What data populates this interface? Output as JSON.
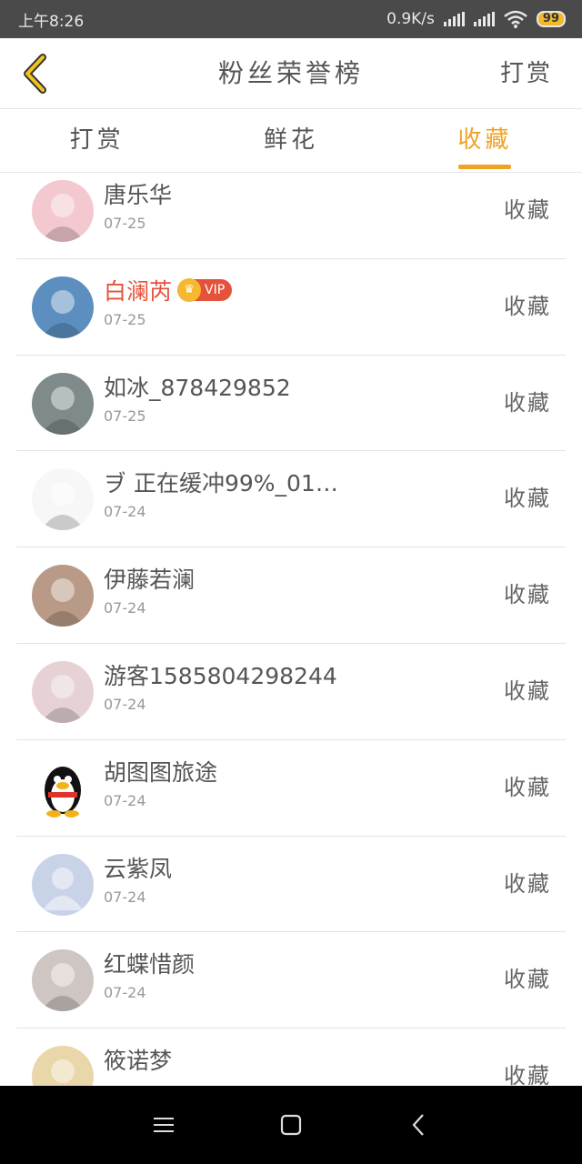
{
  "status_bar": {
    "time": "上午8:26",
    "net_speed": "0.9K/s",
    "battery": "99"
  },
  "header": {
    "title": "粉丝荣誉榜",
    "action_label": "打赏"
  },
  "tabs": [
    {
      "label": "打赏",
      "active": false
    },
    {
      "label": "鲜花",
      "active": false
    },
    {
      "label": "收藏",
      "active": true
    }
  ],
  "fans": [
    {
      "name": "唐乐华",
      "date": "07-25",
      "action": "收藏",
      "vip": false,
      "avatar_icon": "anime-girl-pink-avatar",
      "avatar_color": "#f3c9cf"
    },
    {
      "name": "白澜芮",
      "date": "07-25",
      "action": "收藏",
      "vip": true,
      "vip_label": "VIP",
      "avatar_icon": "girl-back-view-avatar",
      "avatar_color": "#5c8fbf"
    },
    {
      "name": "如冰_878429852",
      "date": "07-25",
      "action": "收藏",
      "vip": false,
      "avatar_icon": "ocean-wave-avatar",
      "avatar_color": "#7f8a8a"
    },
    {
      "name": "ヺ 正在缓冲99%_01…",
      "date": "07-24",
      "action": "收藏",
      "vip": false,
      "avatar_icon": "pixel-cartoon-avatar",
      "avatar_color": "#f7f7f7"
    },
    {
      "name": "伊藤若澜",
      "date": "07-24",
      "action": "收藏",
      "vip": false,
      "avatar_icon": "anime-girl-brown-hair-avatar",
      "avatar_color": "#b89a86"
    },
    {
      "name": "游客1585804298244",
      "date": "07-24",
      "action": "收藏",
      "vip": false,
      "avatar_icon": "anime-girl-bear-avatar",
      "avatar_color": "#e6d2d4"
    },
    {
      "name": "胡图图旅途",
      "date": "07-24",
      "action": "收藏",
      "vip": false,
      "avatar_icon": "penguin-avatar",
      "avatar_color": "#ffffff"
    },
    {
      "name": "云紫凤",
      "date": "07-24",
      "action": "收藏",
      "vip": false,
      "avatar_icon": "default-person-avatar",
      "avatar_color": "#c9d3e8"
    },
    {
      "name": "红蝶惜颜",
      "date": "07-24",
      "action": "收藏",
      "vip": false,
      "avatar_icon": "anime-girl-white-hair-avatar",
      "avatar_color": "#cfc6c4"
    },
    {
      "name": "筱诺梦",
      "date": "",
      "action": "收藏",
      "vip": false,
      "avatar_icon": "anime-girl-red-hair-avatar",
      "avatar_color": "#e9d7a9"
    }
  ],
  "colors": {
    "accent": "#f0a225",
    "vip": "#e5523b",
    "status_bar_bg": "#4a4a4a",
    "nav_bar_bg": "#000000"
  }
}
